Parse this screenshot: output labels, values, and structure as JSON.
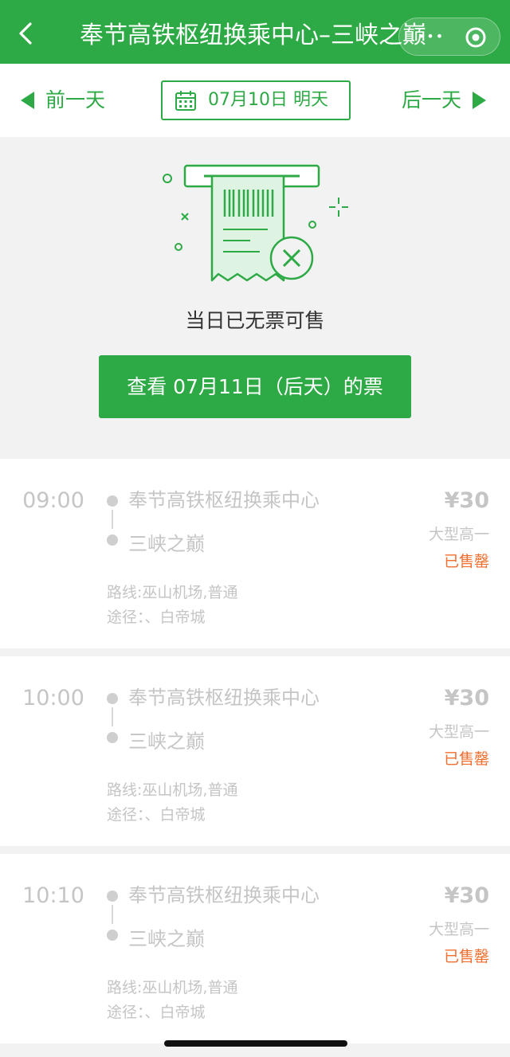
{
  "header": {
    "title": "奉节高铁枢纽换乘中心–三峡之巅",
    "bg_color": "#2daa45",
    "back_icon": "chevron-left-icon",
    "capsule": {
      "more_icon": "more-dots-icon",
      "close_icon": "target-close-icon"
    }
  },
  "datebar": {
    "prev_label": "前一天",
    "next_label": "后一天",
    "date_label": "07月10日  明天",
    "calendar_icon": "calendar-icon"
  },
  "empty_state": {
    "illustration": "ticket-unavailable-icon",
    "message": "当日已无票可售",
    "button_label": "查看 07月11日（后天）的票"
  },
  "schedules": [
    {
      "time": "09:00",
      "from": "奉节高铁枢纽换乘中心",
      "to": "三峡之巅",
      "price": "¥30",
      "bus_type": "大型高一",
      "status": "已售罄",
      "route": "路线:巫山机场,普通",
      "via": "途径：、白帝城"
    },
    {
      "time": "10:00",
      "from": "奉节高铁枢纽换乘中心",
      "to": "三峡之巅",
      "price": "¥30",
      "bus_type": "大型高一",
      "status": "已售罄",
      "route": "路线:巫山机场,普通",
      "via": "途径：、白帝城"
    },
    {
      "time": "10:10",
      "from": "奉节高铁枢纽换乘中心",
      "to": "三峡之巅",
      "price": "¥30",
      "bus_type": "大型高一",
      "status": "已售罄",
      "route": "路线:巫山机场,普通",
      "via": "途径：、白帝城"
    }
  ],
  "colors": {
    "accent": "#2daa45",
    "sold_out": "#f36d2d",
    "muted_text": "#c5c5c5"
  }
}
